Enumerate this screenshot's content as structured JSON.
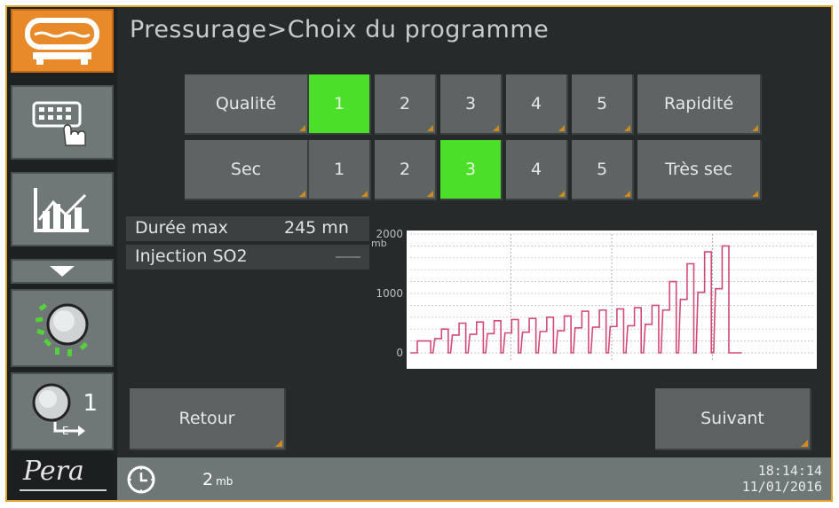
{
  "title": "Pressurage>Choix du programme",
  "logo_text": "Pera",
  "sidebar": {
    "items": [
      {
        "icon": "press-icon",
        "active": true
      },
      {
        "icon": "keyboard-hand-icon",
        "active": false
      },
      {
        "icon": "chart-icon",
        "active": false
      },
      {
        "icon": "chevron-down-icon",
        "active": false
      },
      {
        "icon": "start-cycle-icon",
        "active": false
      },
      {
        "icon": "press-number-icon",
        "active": false,
        "label": "1"
      }
    ]
  },
  "programs": {
    "row1": {
      "left_label": "Qualité",
      "numbers": [
        "1",
        "2",
        "3",
        "4",
        "5"
      ],
      "selected": "1",
      "right_label": "Rapidité"
    },
    "row2": {
      "left_label": "Sec",
      "numbers": [
        "1",
        "2",
        "3",
        "4",
        "5"
      ],
      "selected": "3",
      "right_label": "Très sec"
    }
  },
  "info": {
    "duration_label": "Durée max",
    "duration_value": "245 mn",
    "injection_label": "Injection SO2"
  },
  "chart_data": {
    "type": "line",
    "yunit": "mb",
    "yticks": [
      "0",
      "1000",
      "2000"
    ],
    "ylim": [
      0,
      2000
    ],
    "grid": true,
    "cycles": [
      {
        "plateau": 200,
        "steps": 1
      },
      {
        "plateau": 400,
        "steps": 2
      },
      {
        "plateau": 500,
        "steps": 2
      },
      {
        "plateau": 520,
        "steps": 2
      },
      {
        "plateau": 540,
        "steps": 2
      },
      {
        "plateau": 560,
        "steps": 2
      },
      {
        "plateau": 580,
        "steps": 2
      },
      {
        "plateau": 600,
        "steps": 2
      },
      {
        "plateau": 620,
        "steps": 2
      },
      {
        "plateau": 700,
        "steps": 2
      },
      {
        "plateau": 720,
        "steps": 2
      },
      {
        "plateau": 740,
        "steps": 2
      },
      {
        "plateau": 760,
        "steps": 2
      },
      {
        "plateau": 800,
        "steps": 2
      },
      {
        "plateau": 1200,
        "steps": 2
      },
      {
        "plateau": 1500,
        "steps": 2
      },
      {
        "plateau": 1700,
        "steps": 2
      },
      {
        "plateau": 1800,
        "steps": 2
      }
    ],
    "line_color": "#d24a78"
  },
  "buttons": {
    "back": "Retour",
    "next": "Suivant"
  },
  "status": {
    "pressure_value": "2",
    "pressure_unit": "mb",
    "time": "18:14:14",
    "date": "11/01/2016"
  }
}
